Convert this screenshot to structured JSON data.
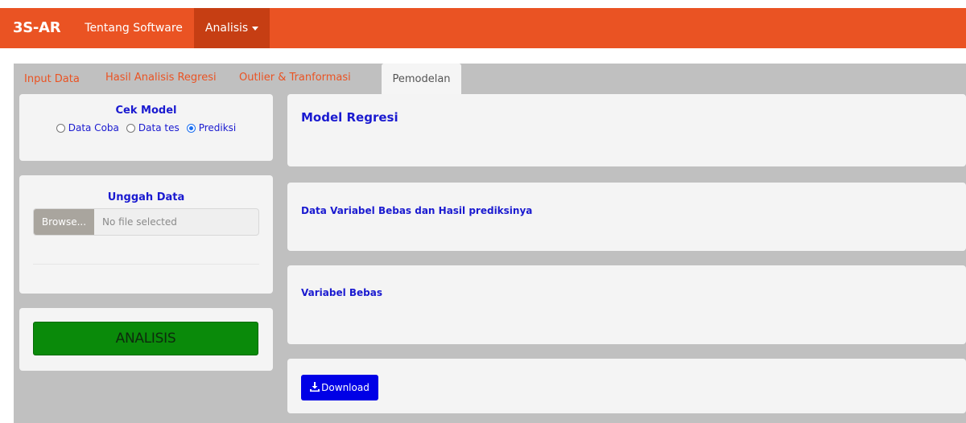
{
  "navbar": {
    "brand": "3S-AR",
    "links": [
      "Tentang Software",
      "Analisis"
    ],
    "color": "#ea5323"
  },
  "tabs": [
    "Input Data",
    "Hasil Analisis Regresi",
    "Outlier & Tranformasi",
    "Pemodelan"
  ],
  "active_tab": "Pemodelan",
  "cek_model": {
    "title": "Cek Model",
    "options": [
      "Data Coba",
      "Data tes",
      "Prediksi"
    ],
    "selected": "Prediksi"
  },
  "upload": {
    "title": "Unggah Data",
    "browse_label": "Browse...",
    "placeholder": "No file selected"
  },
  "analisis_button": "ANALISIS",
  "right": {
    "model_title": "Model Regresi",
    "data_title": "Data Variabel Bebas dan Hasil prediksinya",
    "variabel_title": "Variabel Bebas",
    "download_label": "Download"
  }
}
